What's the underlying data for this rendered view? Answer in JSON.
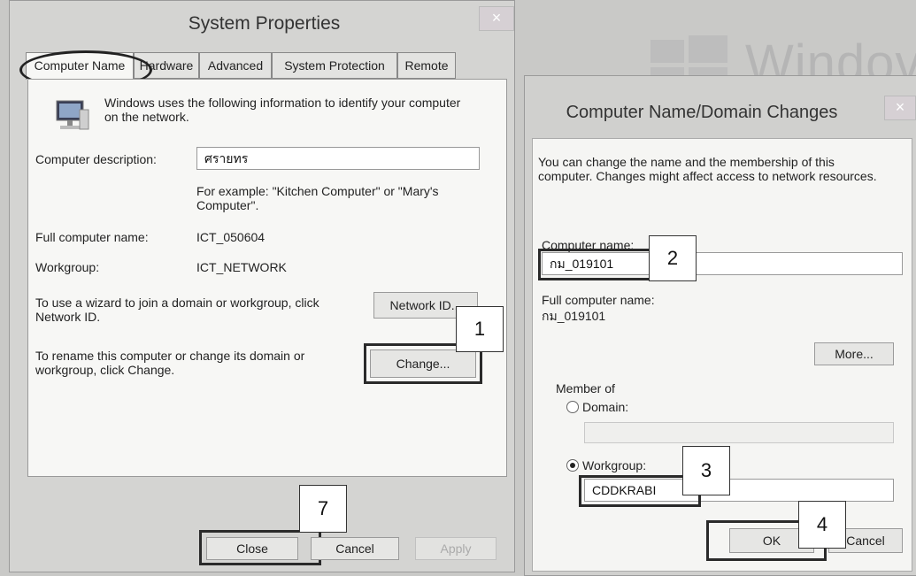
{
  "system_properties": {
    "title": "System Properties",
    "close_glyph": "×",
    "tabs": [
      "Computer Name",
      "Hardware",
      "Advanced",
      "System Protection",
      "Remote"
    ],
    "info_text_line1": "Windows uses the following information to identify your computer",
    "info_text_line2": "on the network.",
    "description_label": "Computer description:",
    "description_value": "ศรายทร",
    "example_line1": "For example: \"Kitchen Computer\" or \"Mary's",
    "example_line2": "Computer\".",
    "full_name_label": "Full computer name:",
    "full_name_value": "ICT_050604",
    "workgroup_label": "Workgroup:",
    "workgroup_value": "ICT_NETWORK",
    "wizard_text_line1": "To use a wizard to join a domain or workgroup, click",
    "wizard_text_line2": "Network ID.",
    "network_id_button": "Network ID...",
    "rename_text_line1": "To rename this computer or change its domain or",
    "rename_text_line2": "workgroup, click Change.",
    "change_button": "Change...",
    "close_button": "Close",
    "cancel_button": "Cancel",
    "apply_button": "Apply"
  },
  "logo": {
    "text": "Windov"
  },
  "domain_changes": {
    "title": "Computer Name/Domain Changes",
    "close_glyph": "×",
    "intro_line1": "You can change the name and the membership of this",
    "intro_line2": "computer. Changes might affect access to network resources.",
    "computer_name_label": "Computer name:",
    "computer_name_value": "กม_019101",
    "full_name_label": "Full computer name:",
    "full_name_value": "กม_019101",
    "more_button": "More...",
    "member_of_label": "Member of",
    "domain_label": "Domain:",
    "domain_value": "",
    "workgroup_label": "Workgroup:",
    "workgroup_value": "CDDKRABI",
    "ok_button": "OK",
    "cancel_button": "Cancel",
    "selected_membership": "Workgroup"
  },
  "step_markers": [
    "1",
    "2",
    "3",
    "4",
    "7"
  ],
  "colors": {
    "dialog_frame": "#d4d4d2",
    "panel": "#f7f7f5",
    "highlight_border": "#2a2a2a"
  }
}
